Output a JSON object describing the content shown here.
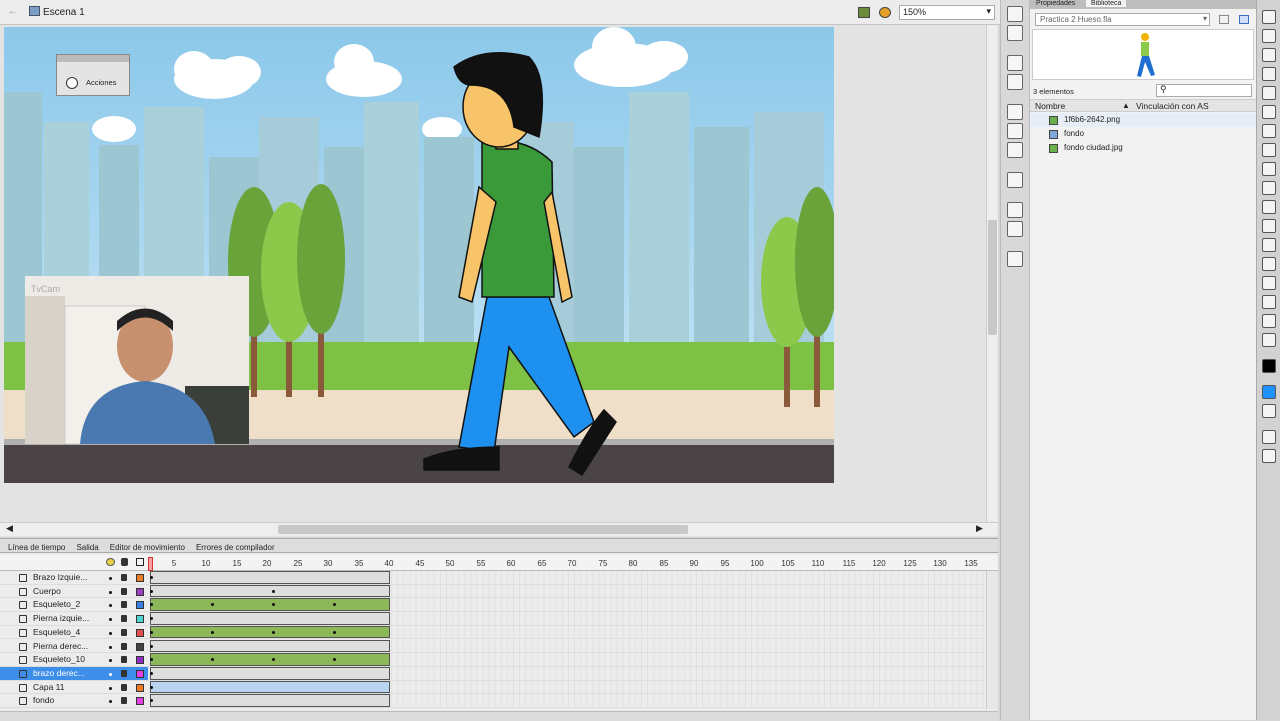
{
  "doc": {
    "scene_label": "Escena 1",
    "zoom": "150%"
  },
  "stage": {
    "panel_title": "Acciones",
    "cam_label": "TvCam"
  },
  "timeline": {
    "tabs": [
      "Línea de tiempo",
      "Salida",
      "Editor de movimiento",
      "Errores de compilador"
    ],
    "ruler": [
      "5",
      "10",
      "15",
      "20",
      "25",
      "30",
      "35",
      "40",
      "45",
      "50",
      "55",
      "60",
      "65",
      "70",
      "75",
      "80",
      "85",
      "90",
      "95",
      "100",
      "105",
      "110",
      "115",
      "120",
      "125",
      "130",
      "135"
    ],
    "layers": [
      {
        "name": "Brazo Izquie...",
        "icon": "symbol-layer-icon",
        "color": "#e87c2b",
        "span": "gray",
        "keys": [
          0
        ]
      },
      {
        "name": "Cuerpo",
        "icon": "symbol-layer-icon",
        "color": "#9b3fc2",
        "span": "gray",
        "keys": [
          0,
          20
        ]
      },
      {
        "name": "Esqueleto_2",
        "icon": "armature-layer-icon",
        "color": "#3c7ee0",
        "span": "green",
        "keys": [
          0,
          10,
          20,
          30
        ]
      },
      {
        "name": "Pierna izquie...",
        "icon": "symbol-layer-icon",
        "color": "#4fd3d3",
        "span": "gray",
        "keys": [
          0
        ]
      },
      {
        "name": "Esqueleto_4",
        "icon": "armature-layer-icon",
        "color": "#e05050",
        "span": "green",
        "keys": [
          0,
          10,
          20,
          30
        ]
      },
      {
        "name": "Pierna derec...",
        "icon": "symbol-layer-icon",
        "color": "#444444",
        "span": "gray",
        "keys": [
          0
        ]
      },
      {
        "name": "Esqueleto_10",
        "icon": "armature-layer-icon",
        "color": "#8a2fc2",
        "span": "green",
        "keys": [
          0,
          10,
          20,
          30
        ]
      },
      {
        "name": "brazo derec...",
        "icon": "symbol-layer-icon",
        "color": "#e040e0",
        "span": "gray",
        "keys": [
          0
        ],
        "selected": true
      },
      {
        "name": "Capa 11",
        "icon": "layer-icon",
        "color": "#e87c2b",
        "span": "blue",
        "keys": [
          0
        ]
      },
      {
        "name": "fondo",
        "icon": "symbol-layer-icon",
        "color": "#e040e0",
        "span": "gray",
        "keys": [
          0
        ]
      }
    ]
  },
  "panels": {
    "tab_props": "Propiedades",
    "tab_lib": "Biblioteca"
  },
  "library": {
    "file": "Practica 2 Hueso.fla",
    "count": "3 elementos",
    "col_name": "Nombre",
    "col_link": "Vinculación con AS",
    "items": [
      {
        "name": "1f6b6-2642.png",
        "icon": "bitmap-icon"
      },
      {
        "name": "fondo",
        "icon": "movieclip-icon"
      },
      {
        "name": "fondo ciudad.jpg",
        "icon": "bitmap-icon"
      }
    ]
  },
  "colors": {
    "stroke": "#000000",
    "fill": "#1e90ff",
    "selected_layer": "#3d8ee8"
  }
}
